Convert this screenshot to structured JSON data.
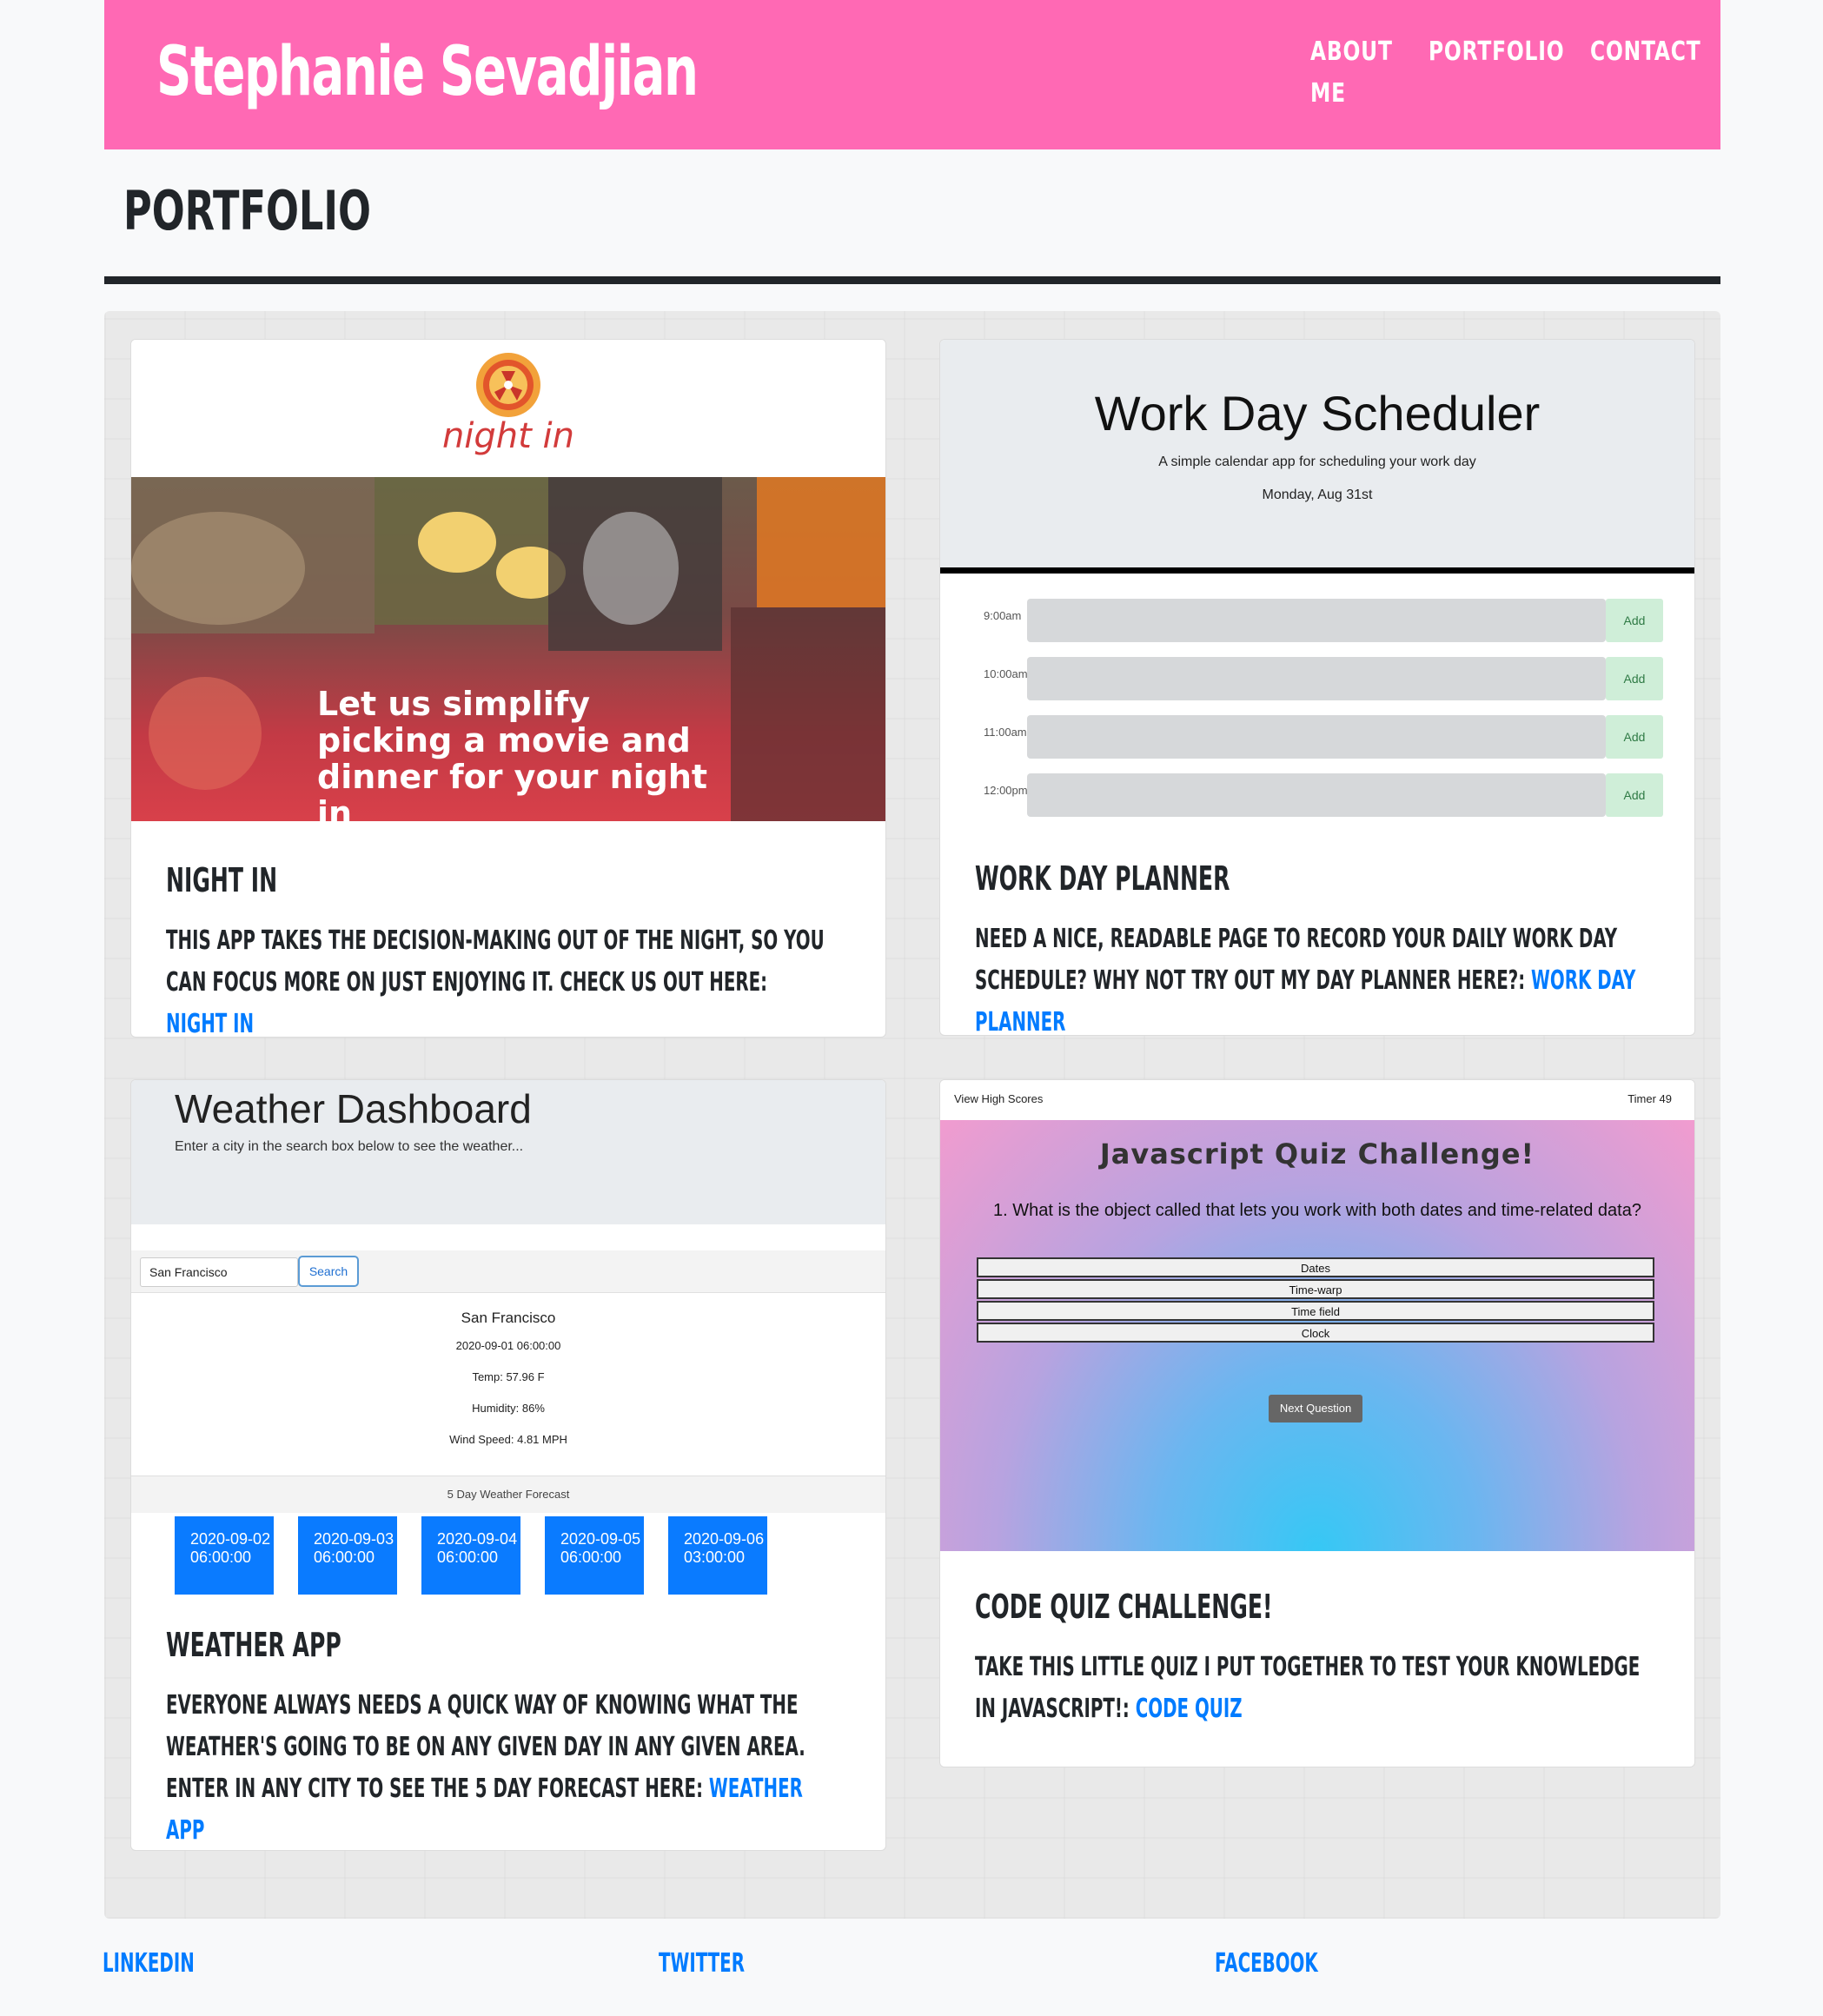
{
  "header": {
    "brand": "Stephanie Sevadjian",
    "nav": {
      "about": "About Me",
      "portfolio": "Portfolio",
      "contact": "Contact"
    }
  },
  "page": {
    "title": "Portfolio"
  },
  "colors": {
    "header": "#ff69b4",
    "link": "#007bff",
    "text": "#212529"
  },
  "cards": [
    {
      "title": "Night In",
      "text": "This app takes the decision-making out of the night, so you can focus more on just enjoying it. Check us out here: ",
      "link": "Night In",
      "preview": {
        "logo_word": "night in",
        "hero_text": "Let us simplify picking a movie and dinner for your night in"
      }
    },
    {
      "title": "Work Day Planner",
      "text": "Need a nice, readable page to record your daily work day schedule? Why not try out my day planner here?: ",
      "link": "Work Day Planner",
      "preview": {
        "heading": "Work Day Scheduler",
        "subtitle": "A simple calendar app for scheduling your work day",
        "date": "Monday, Aug 31st",
        "rows": [
          {
            "time": "9:00am",
            "button": "Add"
          },
          {
            "time": "10:00am",
            "button": "Add"
          },
          {
            "time": "11:00am",
            "button": "Add"
          },
          {
            "time": "12:00pm",
            "button": "Add"
          }
        ]
      }
    },
    {
      "title": "Weather App",
      "text": "Everyone always needs a quick way of knowing what the weather's going to be on any given day in any given area. Enter in any city to see the 5 day forecast here: ",
      "link": "Weather App",
      "preview": {
        "heading": "Weather Dashboard",
        "subtitle": "Enter a city in the search box below to see the weather...",
        "search_value": "San Francisco",
        "search_button": "Search",
        "city": "San Francisco",
        "datetime": "2020-09-01 06:00:00",
        "temp": "Temp: 57.96 F",
        "humidity": "Humidity: 86%",
        "wind": "Wind Speed: 4.81 MPH",
        "forecast_label": "5 Day Weather Forecast",
        "forecast": [
          "2020-09-02 06:00:00",
          "2020-09-03 06:00:00",
          "2020-09-04 06:00:00",
          "2020-09-05 06:00:00",
          "2020-09-06 03:00:00"
        ]
      }
    },
    {
      "title": "Code Quiz Challenge!",
      "text": "Take this little quiz I put together to test your knowledge in JavaScript!: ",
      "link": "Code Quiz",
      "preview": {
        "high_scores": "View High Scores",
        "timer": "Timer 49",
        "heading": "Javascript Quiz Challenge!",
        "question": "1. What is the object called that lets you work with both dates and time-related data?",
        "options": [
          "Dates",
          "Time-warp",
          "Time field",
          "Clock"
        ],
        "next_button": "Next Question"
      }
    }
  ],
  "footer": {
    "linkedin": "LinkedIn",
    "twitter": "Twitter",
    "facebook": "Facebook"
  }
}
